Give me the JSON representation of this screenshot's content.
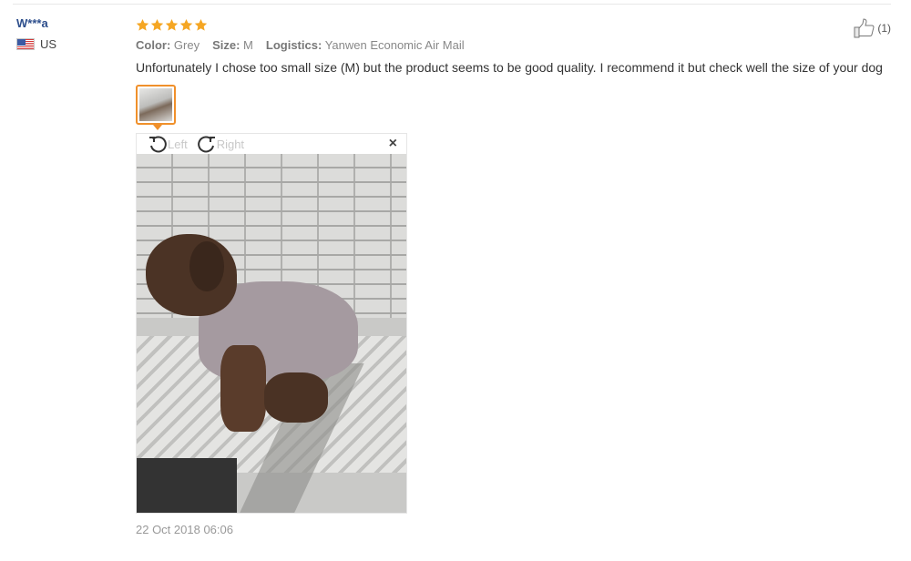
{
  "reviewer": {
    "name": "W***a",
    "country": "US",
    "flag_icon": "us-flag-icon"
  },
  "review": {
    "rating": 5,
    "star_color": "#f5a623",
    "meta": {
      "color_label": "Color:",
      "color_value": "Grey",
      "size_label": "Size:",
      "size_value": "M",
      "logistics_label": "Logistics:",
      "logistics_value": "Yanwen Economic Air Mail"
    },
    "text": "Unfortunately I chose too small size (M) but the product seems to be good quality. I recommend it but check well the size of your dog",
    "timestamp": "22 Oct 2018 06:06"
  },
  "viewer": {
    "rotate_left_label": "Left",
    "rotate_right_label": "Right",
    "close_symbol": "×"
  },
  "helpful": {
    "icon": "thumbs-up-icon",
    "count_text": "(1)"
  },
  "colors": {
    "name_link": "#2d4e8c",
    "thumb_border": "#f0902b"
  }
}
